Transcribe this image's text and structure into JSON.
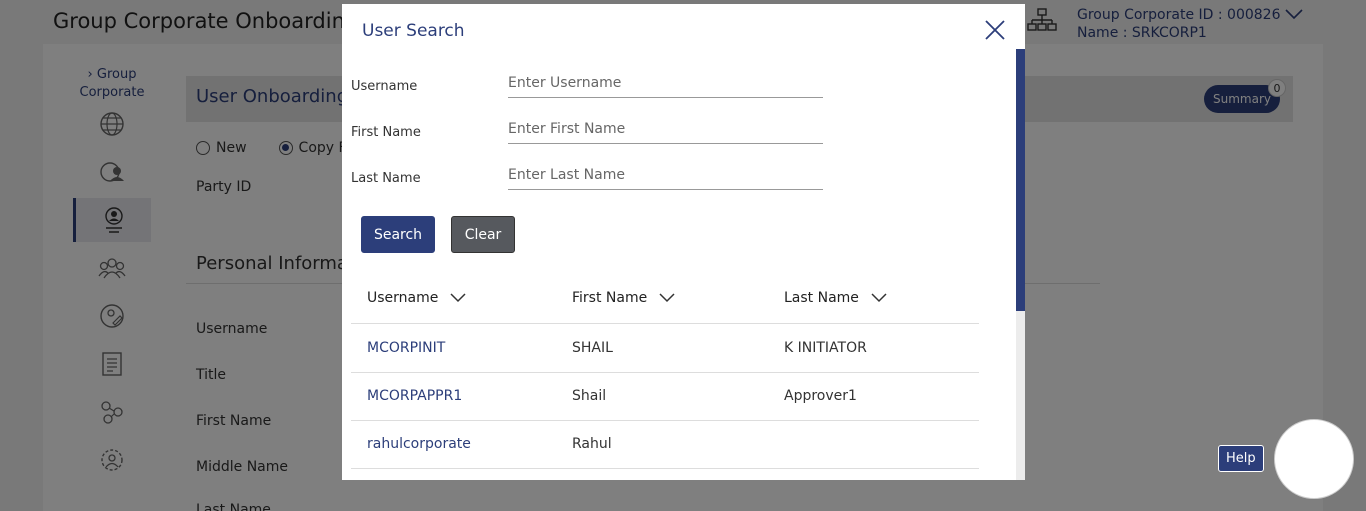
{
  "page": {
    "title": "Group Corporate Onboarding",
    "corporate_id_line": "Group Corporate ID : 000826",
    "name_line": "Name : SRKCORP1"
  },
  "nav": {
    "parent_label": "Group Corporate"
  },
  "section": {
    "title": "User Onboarding",
    "summary_label": "Summary",
    "summary_count": "0"
  },
  "background_form": {
    "radio_new": "New",
    "radio_copy": "Copy F",
    "party_id_label": "Party ID",
    "personal_info_heading": "Personal Informat",
    "labels": [
      "Username",
      "Title",
      "First Name",
      "Middle Name",
      "Last Name"
    ]
  },
  "modal": {
    "title": "User Search",
    "fields": {
      "username": {
        "label": "Username",
        "placeholder": "Enter Username"
      },
      "first_name": {
        "label": "First Name",
        "placeholder": "Enter First Name"
      },
      "last_name": {
        "label": "Last Name",
        "placeholder": "Enter Last Name"
      }
    },
    "search_button": "Search",
    "clear_button": "Clear",
    "columns": [
      "Username",
      "First Name",
      "Last Name"
    ],
    "rows": [
      {
        "username": "MCORPINIT",
        "first_name": "SHAIL",
        "last_name": "K INITIATOR"
      },
      {
        "username": "MCORPAPPR1",
        "first_name": "Shail",
        "last_name": "Approver1"
      },
      {
        "username": "rahulcorporate",
        "first_name": "Rahul",
        "last_name": ""
      }
    ]
  },
  "help": {
    "label": "Help"
  },
  "colors": {
    "primary": "#2c3e7a",
    "clear_button": "#56595e",
    "overlay": "rgba(0,0,0,0.5)"
  }
}
